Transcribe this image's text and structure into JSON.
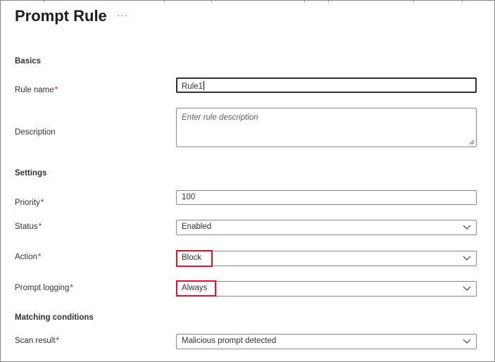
{
  "page": {
    "title": "Prompt Rule",
    "more_label": "···"
  },
  "basics": {
    "heading": "Basics",
    "rule_name": {
      "label": "Rule name",
      "required_mark": "*",
      "value": "Rule1"
    },
    "description": {
      "label": "Description",
      "placeholder": "Enter rule description"
    }
  },
  "settings": {
    "heading": "Settings",
    "priority": {
      "label": "Priority",
      "required_mark": "*",
      "value": "100"
    },
    "status": {
      "label": "Status",
      "required_mark": "*",
      "value": "Enabled"
    },
    "action": {
      "label": "Action",
      "required_mark": "*",
      "value": "Block"
    },
    "prompt_logging": {
      "label": "Prompt logging",
      "required_mark": "*",
      "value": "Always"
    }
  },
  "matching": {
    "heading": "Matching conditions",
    "scan_result": {
      "label": "Scan result",
      "required_mark": "*",
      "value": "Malicious prompt detected"
    }
  },
  "icons": {
    "more": "ellipsis-icon",
    "dropdown": "chevron-down-icon",
    "resize": "resize-grip-icon"
  },
  "colors": {
    "required": "#a4262c",
    "highlight": "#e81123",
    "border": "#8a8886",
    "text": "#323130"
  }
}
